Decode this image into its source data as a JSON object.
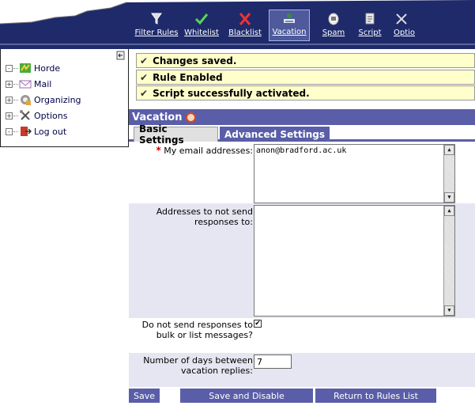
{
  "toolbar": {
    "items": [
      {
        "label": "Filter Rules",
        "icon": "filter-icon",
        "active": false
      },
      {
        "label": "Whitelist",
        "icon": "checkmark-icon",
        "active": false
      },
      {
        "label": "Blacklist",
        "icon": "x-icon",
        "active": false
      },
      {
        "label": "Vacation",
        "icon": "vacation-icon",
        "active": true
      },
      {
        "label": "Spam",
        "icon": "spam-icon",
        "active": false
      },
      {
        "label": "Script",
        "icon": "script-icon",
        "active": false
      },
      {
        "label": "Optio",
        "icon": "options-icon",
        "active": false
      }
    ],
    "bg_color": "#1f2a6b"
  },
  "sidebar": {
    "items": [
      {
        "label": "Horde",
        "icon": "horde-icon",
        "expander": "-"
      },
      {
        "label": "Mail",
        "icon": "envelope-icon",
        "expander": "+"
      },
      {
        "label": "Organizing",
        "icon": "organizing-icon",
        "expander": "+"
      },
      {
        "label": "Options",
        "icon": "tools-icon",
        "expander": "+"
      },
      {
        "label": "Log out",
        "icon": "logout-icon",
        "expander": "-"
      }
    ]
  },
  "notices": [
    {
      "text": "Changes saved."
    },
    {
      "text": "Rule Enabled"
    },
    {
      "text": "Script successfully activated."
    }
  ],
  "header": {
    "title": "Vacation"
  },
  "tabs": [
    {
      "label": "Basic Settings",
      "active": true
    },
    {
      "label": "Advanced Settings",
      "active": false
    }
  ],
  "form": {
    "email_label": "My email addresses:",
    "email_value": "anon@bradford.ac.uk",
    "exclude_label": "Addresses to not send responses to:",
    "exclude_value": "",
    "bulk_label": "Do not send responses to bulk or list messages?",
    "bulk_checked": true,
    "days_label": "Number of days between vacation replies:",
    "days_value": "7"
  },
  "buttons": {
    "save": "Save",
    "save_disable": "Save and Disable",
    "return": "Return to Rules List"
  },
  "colors": {
    "accent": "#5a5ea8",
    "notice_bg": "#ffffcc",
    "required": "#cc0000"
  }
}
